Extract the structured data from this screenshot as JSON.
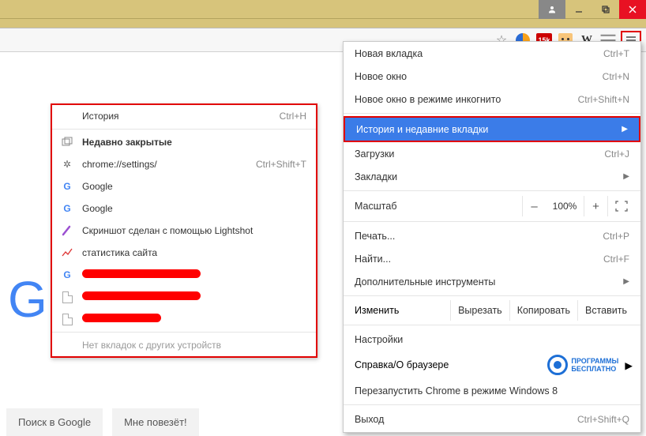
{
  "main_menu": {
    "new_tab": {
      "label": "Новая вкладка",
      "shortcut": "Ctrl+T"
    },
    "new_window": {
      "label": "Новое окно",
      "shortcut": "Ctrl+N"
    },
    "incognito": {
      "label": "Новое окно в режиме инкогнито",
      "shortcut": "Ctrl+Shift+N"
    },
    "history": {
      "label": "История и недавние вкладки"
    },
    "downloads": {
      "label": "Загрузки",
      "shortcut": "Ctrl+J"
    },
    "bookmarks": {
      "label": "Закладки"
    },
    "zoom": {
      "label": "Масштаб",
      "value": "100%"
    },
    "print": {
      "label": "Печать...",
      "shortcut": "Ctrl+P"
    },
    "find": {
      "label": "Найти...",
      "shortcut": "Ctrl+F"
    },
    "more_tools": {
      "label": "Дополнительные инструменты"
    },
    "edit": {
      "label": "Изменить",
      "cut": "Вырезать",
      "copy": "Копировать",
      "paste": "Вставить"
    },
    "settings": {
      "label": "Настройки"
    },
    "about": {
      "label": "Справка/О браузере"
    },
    "relaunch": {
      "label": "Перезапустить Chrome в режиме Windows 8"
    },
    "exit": {
      "label": "Выход",
      "shortcut": "Ctrl+Shift+Q"
    },
    "logo": {
      "line1": "ПРОГРАММЫ",
      "line2": "БЕСПЛАТНО"
    }
  },
  "history_menu": {
    "history": {
      "label": "История",
      "shortcut": "Ctrl+H"
    },
    "recently_closed": {
      "label": "Недавно закрытые"
    },
    "restore": {
      "label": "chrome://settings/",
      "shortcut": "Ctrl+Shift+T"
    },
    "items": [
      {
        "label": "Google"
      },
      {
        "label": "Google"
      },
      {
        "label": "Скриншот сделан с помощью Lightshot"
      },
      {
        "label": "статистика сайта"
      }
    ],
    "no_tabs": "Нет вкладок с других устройств"
  },
  "page": {
    "search_btn": "Поиск в Google",
    "lucky_btn": "Мне повезёт!"
  },
  "toolbar": {
    "norton": "15k",
    "w": "W"
  }
}
